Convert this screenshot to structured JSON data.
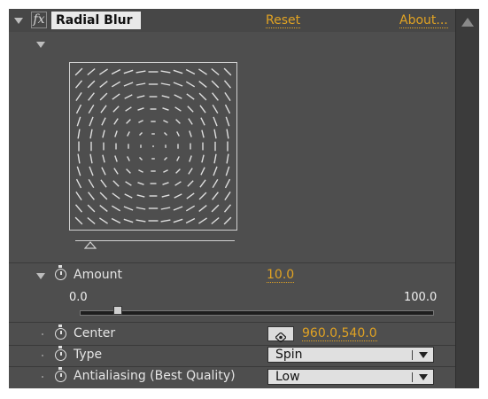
{
  "effect": {
    "title": "Radial Blur",
    "reset_label": "Reset",
    "about_label": "About..."
  },
  "amount": {
    "label": "Amount",
    "value": "10.0",
    "min_label": "0.0",
    "max_label": "100.0",
    "slider_level": 0.1
  },
  "center": {
    "label": "Center",
    "value": "960.0,540.0"
  },
  "type": {
    "label": "Type",
    "selected": "Spin"
  },
  "antialiasing": {
    "label": "Antialiasing (Best Quality)",
    "selected": "Low"
  },
  "icons": [
    "disclosure-triangle-icon",
    "fx-icon",
    "stopwatch-icon",
    "crosshair-icon",
    "dropdown-arrow-icon",
    "scroll-up-arrow-icon"
  ],
  "colors": {
    "accent": "#e0a223",
    "panel": "#4e4e4e",
    "header": "#474747"
  }
}
